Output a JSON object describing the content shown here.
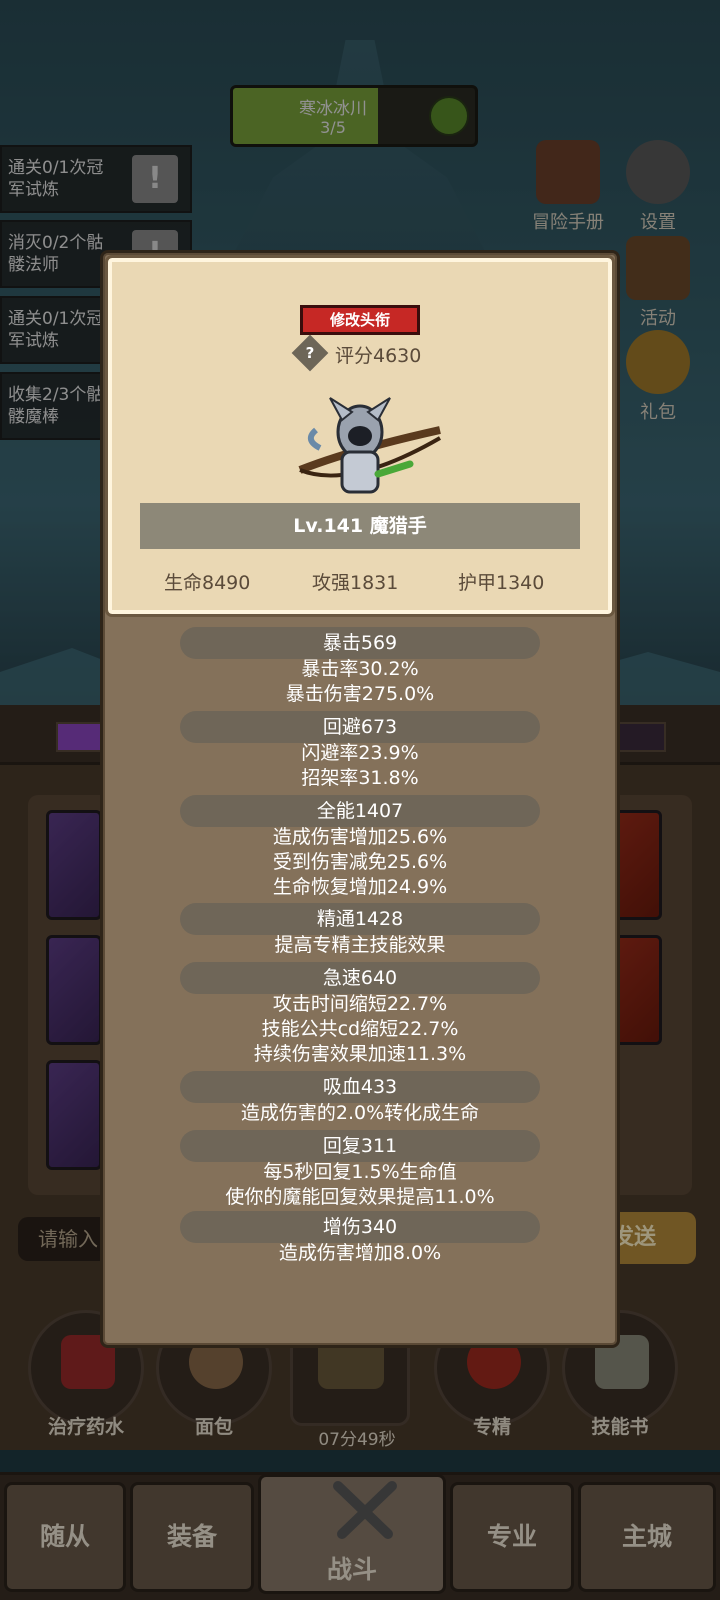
{
  "hud": {
    "stage_name": "寒冰冰川",
    "stage_progress": "3/5",
    "stage_progress_fraction": 0.6
  },
  "quests": [
    {
      "text": "通关0/1次冠军试炼"
    },
    {
      "text": "消灭0/2个骷髅法师"
    },
    {
      "text": "通关0/1次冠军试炼"
    },
    {
      "text": "收集2/3个骷髅魔棒"
    }
  ],
  "side_buttons": {
    "adventure_manual": "冒险手册",
    "settings": "设置",
    "events": "活动",
    "gifts": "礼包"
  },
  "chat": {
    "placeholder": "请输入",
    "send_label": "发送"
  },
  "items": [
    {
      "label": "治疗药水"
    },
    {
      "label": "面包"
    },
    {
      "label": "专精"
    },
    {
      "label": "技能书"
    }
  ],
  "chest_timer": "07分49秒",
  "nav": {
    "followers": "随从",
    "equipment": "装备",
    "battle": "战斗",
    "profession": "专业",
    "main_city": "主城"
  },
  "modal": {
    "title_button": "修改头衔",
    "score": "评分4630",
    "level_class": "Lv.141 魔猎手",
    "base_stats": {
      "hp": "生命8490",
      "attack": "攻强1831",
      "armor": "护甲1340"
    },
    "stat_groups": [
      {
        "header": "暴击569",
        "lines": [
          "暴击率30.2%",
          "暴击伤害275.0%"
        ]
      },
      {
        "header": "回避673",
        "lines": [
          "闪避率23.9%",
          "招架率31.8%"
        ]
      },
      {
        "header": "全能1407",
        "lines": [
          "造成伤害增加25.6%",
          "受到伤害减免25.6%",
          "生命恢复增加24.9%"
        ]
      },
      {
        "header": "精通1428",
        "lines": [
          "提高专精主技能效果"
        ]
      },
      {
        "header": "急速640",
        "lines": [
          "攻击时间缩短22.7%",
          "技能公共cd缩短22.7%",
          "持续伤害效果加速11.3%"
        ]
      },
      {
        "header": "吸血433",
        "lines": [
          "造成伤害的2.0%转化成生命"
        ]
      },
      {
        "header": "回复311",
        "lines": [
          "每5秒回复1.5%生命值",
          "使你的魔能回复效果提高11.0%"
        ]
      },
      {
        "header": "增伤340",
        "lines": [
          "造成伤害增加8.0%"
        ]
      }
    ]
  },
  "colors": {
    "modal_bg": "#84715a",
    "parchment": "#ead8b4",
    "title_button_red": "#c62825",
    "stat_header_bg": "#6f6658"
  }
}
